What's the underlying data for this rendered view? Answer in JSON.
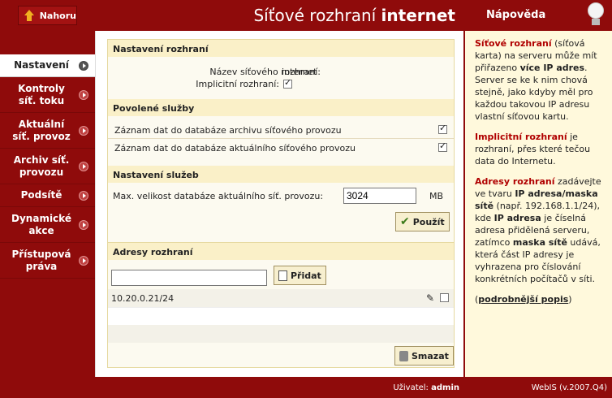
{
  "header": {
    "up_label": "Nahoru",
    "title_prefix": "Síťové rozhraní",
    "title_name": "internet"
  },
  "sidebar": {
    "items": [
      {
        "label": "Nastavení",
        "active": true
      },
      {
        "label": "Kontroly síť. toku"
      },
      {
        "label": "Aktuální síť. provoz"
      },
      {
        "label": "Archiv síť. provozu"
      },
      {
        "label": "Podsítě"
      },
      {
        "label": "Dynamické akce"
      },
      {
        "label": "Přístupová práva"
      }
    ]
  },
  "settings": {
    "head": "Nastavení rozhraní",
    "name_label": "Název síťového rozhraní:",
    "name_value": "internet",
    "default_label": "Implicitní rozhraní:"
  },
  "services": {
    "head": "Povolené služby",
    "items": [
      {
        "label": "Záznam dat do databáze archivu síťového provozu",
        "checked": true
      },
      {
        "label": "Záznam dat do databáze aktuálního síťového provozu",
        "checked": true
      }
    ]
  },
  "service_settings": {
    "head": "Nastavení služeb",
    "db_label": "Max. velikost databáze aktuálního síť. provozu:",
    "db_value": "3024",
    "db_unit": "MB",
    "apply_label": "Použít"
  },
  "addresses": {
    "head": "Adresy rozhraní",
    "input_value": "",
    "add_label": "Přidat",
    "rows": [
      "10.20.0.21/24",
      "",
      ""
    ],
    "delete_label": "Smazat"
  },
  "help": {
    "title": "Nápověda",
    "p1_term": "Síťové rozhraní",
    "p1_a": " (síťová karta) na serveru může mít přiřazeno ",
    "p1_b": "více IP adres",
    "p1_c": ". Server se ke k nim chová stejně, jako kdyby měl pro každou takovou IP adresu vlastní síťovou kartu.",
    "p2_term": "Implicitní rozhraní",
    "p2_text": " je rozhraní, přes které tečou data do Internetu.",
    "p3_term": "Adresy rozhraní",
    "p3_a": " zadávejte ve tvaru ",
    "p3_b": "IP adresa/maska sítě",
    "p3_c": " (např. 192.168.1.1/24), kde ",
    "p3_d": "IP adresa",
    "p3_e": " je číselná adresa přidělená serveru, zatímco ",
    "p3_f": "maska sítě",
    "p3_g": " udává, která část IP adresy je vyhrazena pro číslování konkrétních počítačů v síti.",
    "more_open": "(",
    "more_link": "podrobnější popis",
    "more_close": ")"
  },
  "footer": {
    "user_label": "Uživatel:",
    "user_name": "admin",
    "version": "WebIS (v.2007.Q4)"
  }
}
